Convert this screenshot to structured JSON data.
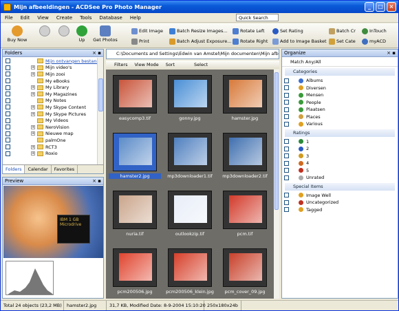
{
  "window": {
    "title": "Mijn afbeeldingen - ACDSee Pro Photo Manager",
    "minimize": "_",
    "maximize": "□",
    "close": "×"
  },
  "menu": [
    "File",
    "Edit",
    "View",
    "Create",
    "Tools",
    "Database",
    "Help"
  ],
  "quick_search": "Quick Search",
  "toolbar": {
    "buy_now": "Buy Now",
    "up": "Up",
    "get_photos": "Get Photos",
    "edit_image": "Edit Image",
    "print": "Print",
    "batch_resize": "Batch Resize Images...",
    "batch_adjust": "Batch Adjust Exposure...",
    "rotate_left": "Rotate Left",
    "rotate_right": "Rotate Right",
    "set_rating": "Set Rating",
    "add_basket": "Add to Image Basket",
    "batch_cr": "Batch Cr",
    "set_cate": "Set Cate",
    "intouch": "InTouch",
    "myacd": "myACD"
  },
  "folders": {
    "title": "Folders",
    "items": [
      "Mijn ontvangen bestand",
      "Mijn video's",
      "Mijn zooi",
      "My eBooks",
      "My Library",
      "My Magazines",
      "My Notes",
      "My Skype Content",
      "My Skype Pictures",
      "My Videos",
      "NeroVision",
      "Nieuwe map",
      "palmOne",
      "RCT3",
      "Roxio"
    ],
    "tabs": [
      "Folders",
      "Calendar",
      "Favorites"
    ]
  },
  "preview": {
    "title": "Preview",
    "card_text": "IBM 1 GB Microdrive"
  },
  "center": {
    "path": "C:\\Documents and Settings\\Edwin van Amstel\\Mijn documenten\\Mijn afbe",
    "filters": "Filters",
    "view_mode": "View Mode",
    "sort": "Sort",
    "select": "Select",
    "files": [
      "easycomp3.tif",
      "gonny.jpg",
      "hamster.jpg",
      "hamster2.jpg",
      "mp3downloader1.tif",
      "mp3downloader2.tif",
      "nuria.tif",
      "outlookzip.tif",
      "pcm.tif",
      "pcm200506.jpg",
      "pcm200506_klein.jpg",
      "pcm_cover_09.jpg"
    ]
  },
  "organize": {
    "title": "Organize",
    "match": "Match Any/All",
    "categories_title": "Categories",
    "categories": [
      "Albums",
      "Diversen",
      "Mensen",
      "People",
      "Plaatsen",
      "Places",
      "Various"
    ],
    "ratings_title": "Ratings",
    "ratings": [
      "1",
      "2",
      "3",
      "4",
      "5",
      "Unrated"
    ],
    "special_title": "Special Items",
    "special": [
      "Image Well",
      "Uncategorized",
      "Tagged"
    ]
  },
  "status": {
    "total": "Total 24 objects  (23,2 MB)",
    "file": "hamster2.jpg",
    "info": "31,7 KB, Modified Date: 8-9-2004 15:10:20",
    "dims": "250x180x24b"
  },
  "colors": {
    "accent": "#3162c5",
    "title": "#0548c8"
  }
}
